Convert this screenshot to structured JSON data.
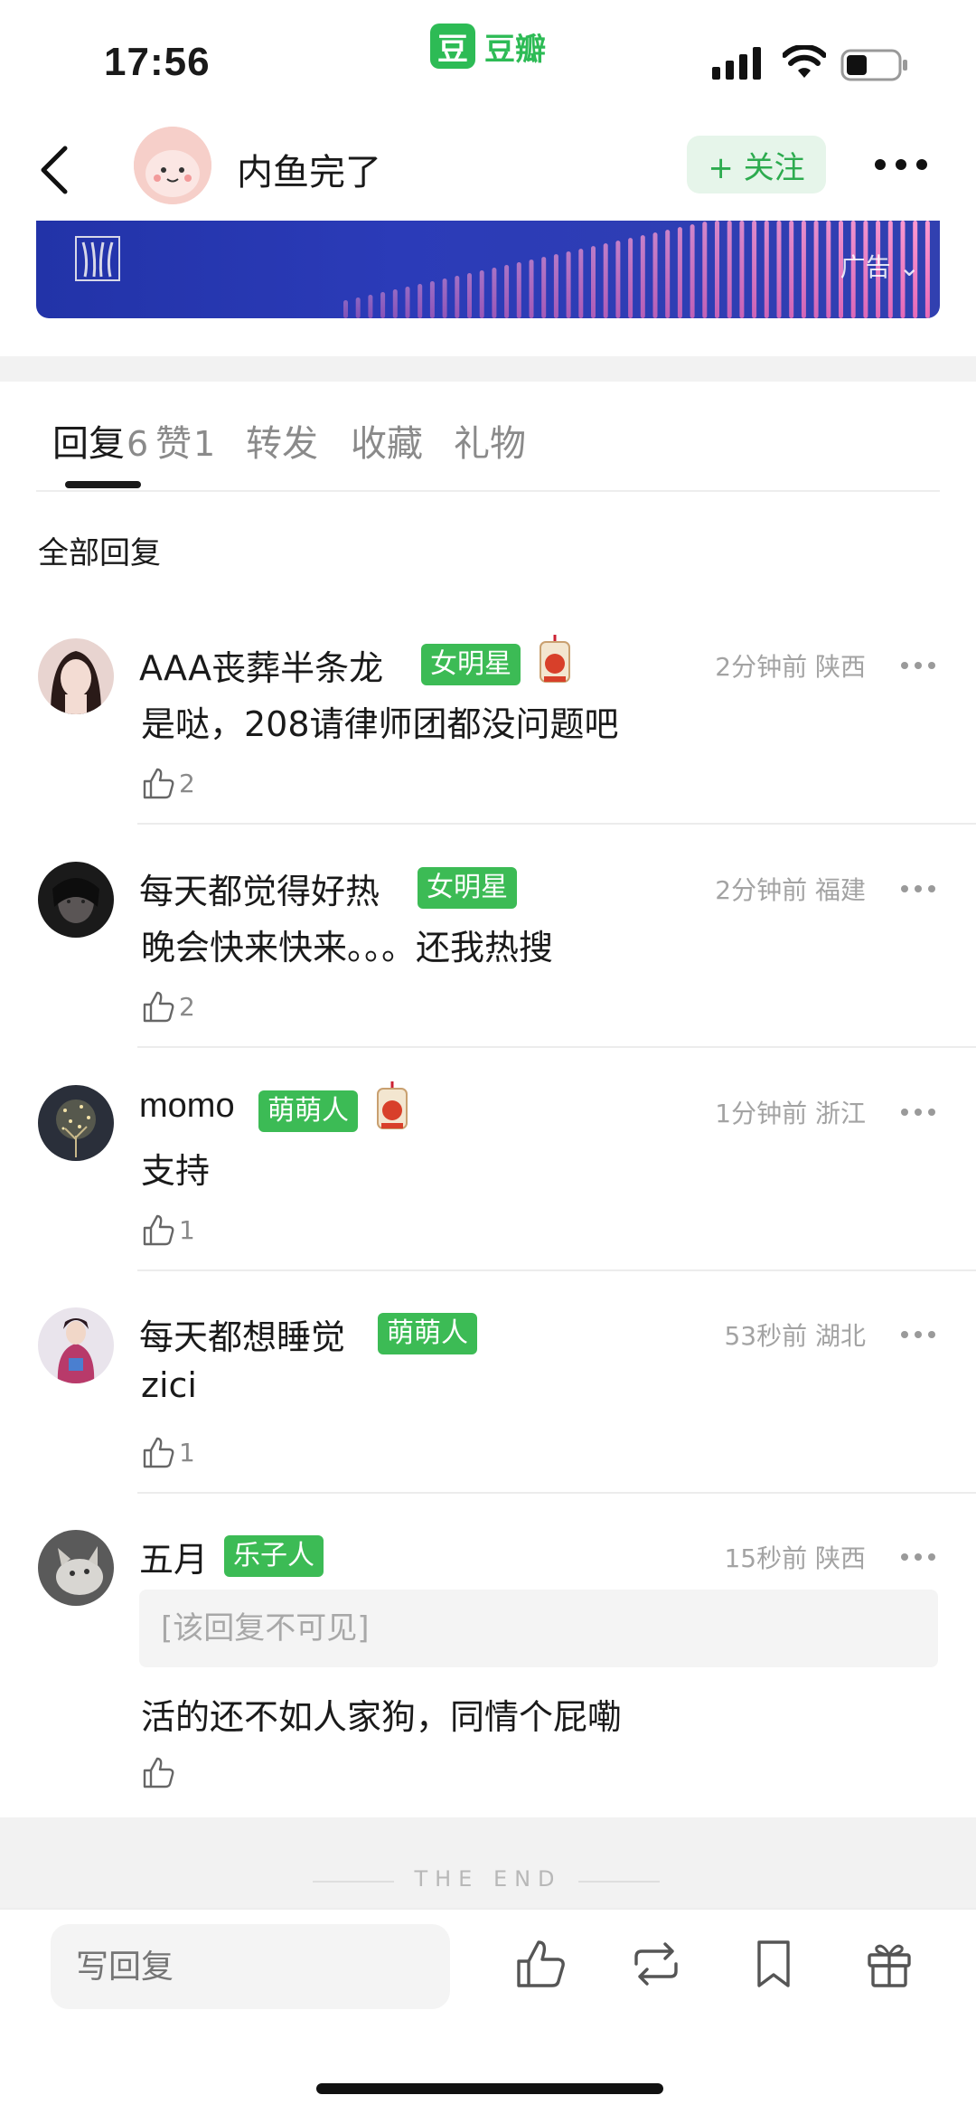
{
  "status_bar": {
    "time": "17:56",
    "app_icon_char": "豆",
    "app_name": "豆瓣"
  },
  "nav": {
    "title": "内鱼完了",
    "follow_label": "+ 关注"
  },
  "ad": {
    "label": "广告"
  },
  "tabs": [
    {
      "label": "回复",
      "count": "6",
      "active": true
    },
    {
      "label": "赞",
      "count": "1",
      "active": false
    },
    {
      "label": "转发",
      "count": "",
      "active": false
    },
    {
      "label": "收藏",
      "count": "",
      "active": false
    },
    {
      "label": "礼物",
      "count": "",
      "active": false
    }
  ],
  "section_title": "全部回复",
  "comments": [
    {
      "name": "AAA丧葬半条龙",
      "badge": "女明星",
      "time": "2分钟前",
      "location": "陕西",
      "text": "是哒，208请律师团都没问题吧",
      "likes": "2",
      "has_charm": true
    },
    {
      "name": "每天都觉得好热",
      "badge": "女明星",
      "time": "2分钟前",
      "location": "福建",
      "text": "晚会快来快来。。。还我热搜",
      "likes": "2",
      "has_charm": false
    },
    {
      "name": "momo",
      "badge": "萌萌人",
      "time": "1分钟前",
      "location": "浙江",
      "text": "支持",
      "likes": "1",
      "has_charm": true
    },
    {
      "name": "每天都想睡觉",
      "badge": "萌萌人",
      "time": "53秒前",
      "location": "湖北",
      "text": "zici",
      "likes": "1",
      "has_charm": false
    },
    {
      "name": "五月",
      "badge": "乐子人",
      "time": "15秒前",
      "location": "陕西",
      "quoted": "[该回复不可见]",
      "text": "活的还不如人家狗，同情个屁嘞",
      "likes": "",
      "has_charm": false
    }
  ],
  "end_text": "THE END",
  "bottom_bar": {
    "reply_placeholder": "写回复"
  },
  "colors": {
    "accent_green": "#3cbb55",
    "ad_blue": "#2b3bb8"
  },
  "icons": [
    "back-arrow-icon",
    "more-dots-icon",
    "thumbs-up-icon",
    "repost-icon",
    "bookmark-icon",
    "gift-icon",
    "charm-icon"
  ]
}
